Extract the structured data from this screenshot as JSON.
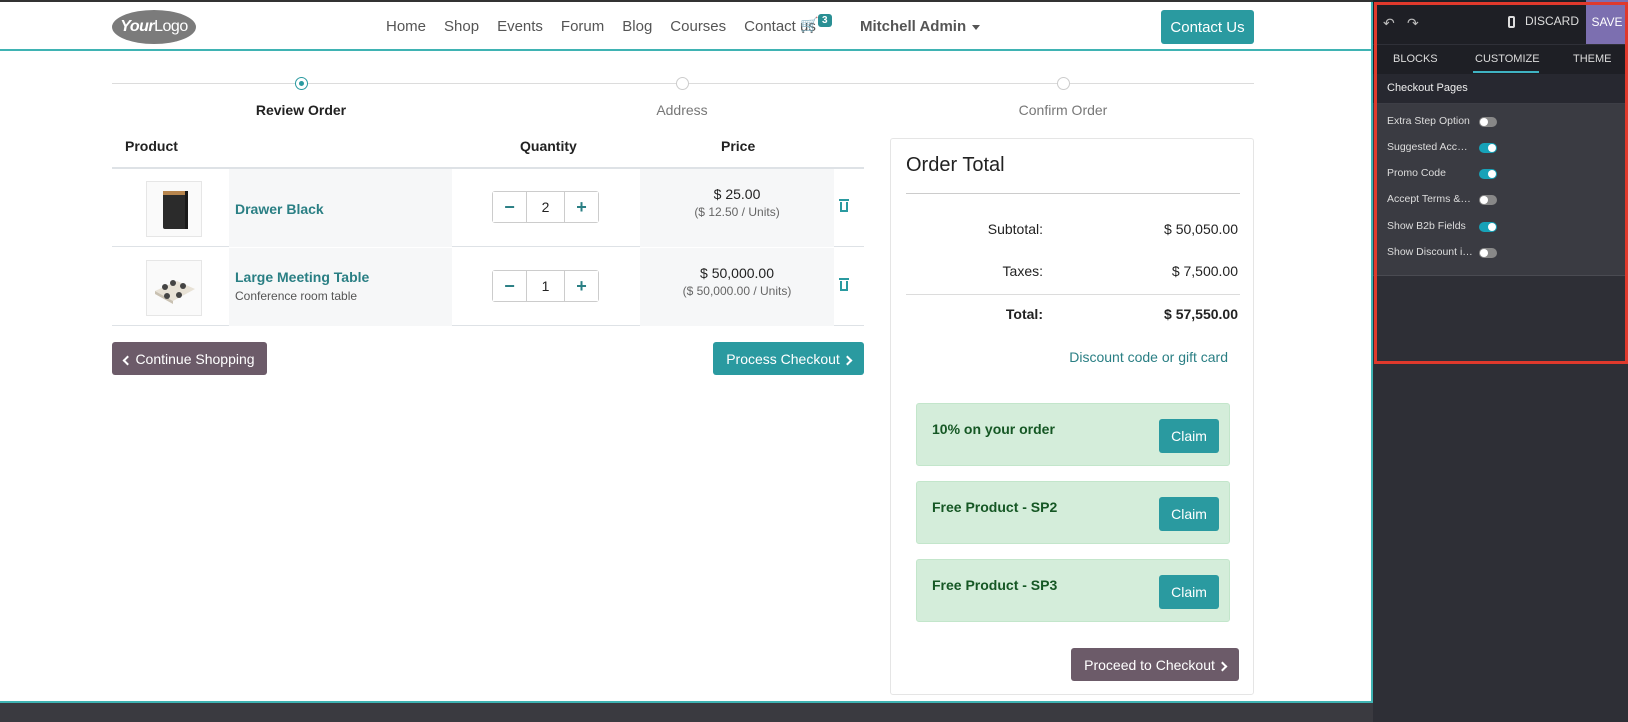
{
  "nav": {
    "logo_bold": "Your",
    "logo_light": "Logo",
    "menu": [
      "Home",
      "Shop",
      "Events",
      "Forum",
      "Blog",
      "Courses",
      "Contact us"
    ],
    "cart_count": "3",
    "user": "Mitchell Admin",
    "contact_button": "Contact Us"
  },
  "wizard": {
    "steps": [
      "Review Order",
      "Address",
      "Confirm Order"
    ],
    "active_step": 0
  },
  "cart": {
    "headers": {
      "product": "Product",
      "quantity": "Quantity",
      "price": "Price"
    },
    "items": [
      {
        "name": "Drawer Black",
        "description": "",
        "qty": "2",
        "price": "$ 25.00",
        "unit_price": "($ 12.50 / Units)"
      },
      {
        "name": "Large Meeting Table",
        "description": "Conference room table",
        "qty": "1",
        "price": "$ 50,000.00",
        "unit_price": "($ 50,000.00 / Units)"
      }
    ],
    "continue_label": "Continue Shopping",
    "process_label": "Process Checkout"
  },
  "order_total": {
    "title": "Order Total",
    "subtotal_label": "Subtotal:",
    "subtotal": "$ 50,050.00",
    "taxes_label": "Taxes:",
    "taxes": "$ 7,500.00",
    "total_label": "Total:",
    "total": "$ 57,550.00",
    "discount_link": "Discount code or gift card",
    "promotions": [
      {
        "name": "10% on your order",
        "claim": "Claim"
      },
      {
        "name": "Free Product - SP2",
        "claim": "Claim"
      },
      {
        "name": "Free Product - SP3",
        "claim": "Claim"
      }
    ],
    "proceed_label": "Proceed to Checkout"
  },
  "editor": {
    "discard": "DISCARD",
    "save": "SAVE",
    "tabs": [
      "BLOCKS",
      "CUSTOMIZE",
      "THEME"
    ],
    "active_tab": "CUSTOMIZE",
    "section_title": "Checkout Pages",
    "options": [
      {
        "label": "Extra Step Option",
        "enabled": false
      },
      {
        "label": "Suggested Accessories",
        "enabled": true
      },
      {
        "label": "Promo Code",
        "enabled": true
      },
      {
        "label": "Accept Terms & Conditions",
        "enabled": false
      },
      {
        "label": "Show B2b Fields",
        "enabled": true
      },
      {
        "label": "Show Discount in Subtotal",
        "enabled": false
      }
    ],
    "accent_color": "#17a2b8"
  },
  "colors": {
    "primary": "#2a9aa0",
    "secondary": "#6c5b69",
    "promo_bg": "#d4edda",
    "highlight_border": "#e0392c"
  }
}
